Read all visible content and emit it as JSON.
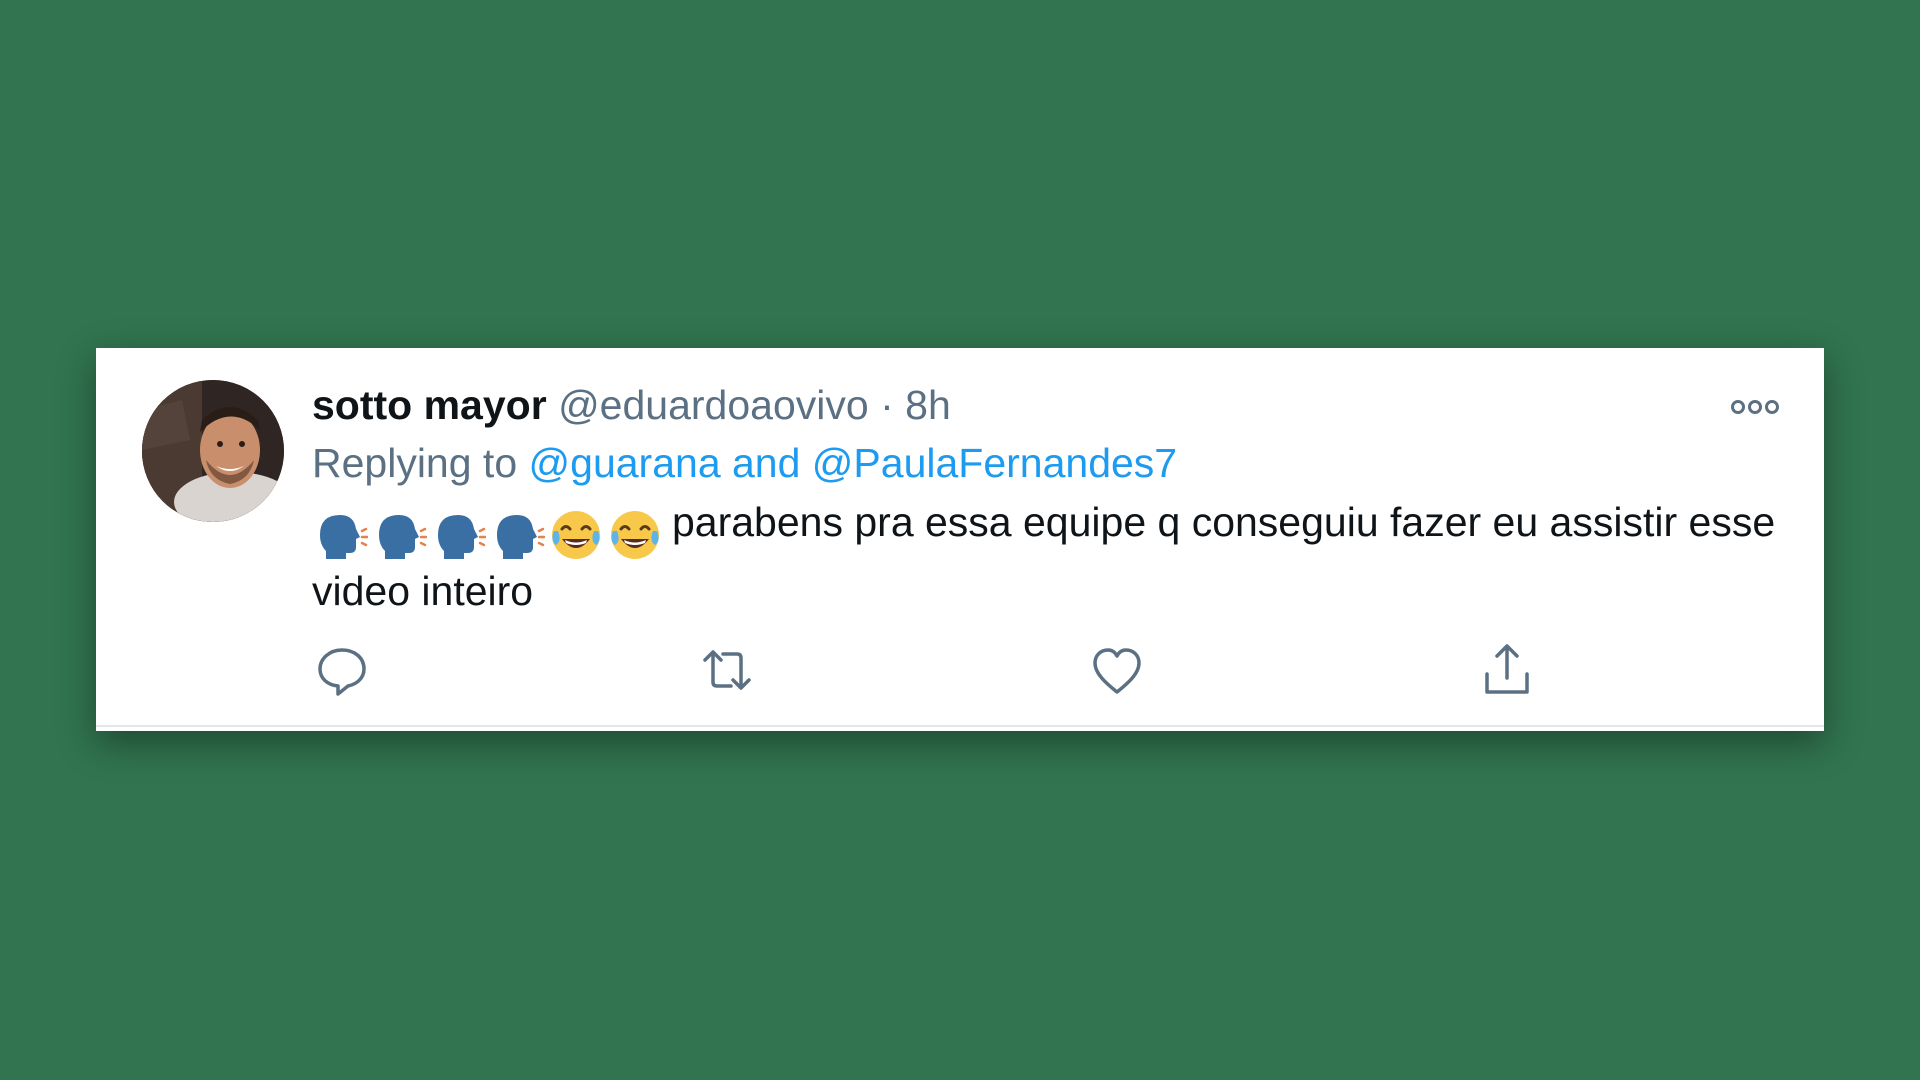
{
  "tweet": {
    "display_name": "sotto mayor",
    "handle": "@eduardoaovivo",
    "separator": "·",
    "time": "8h",
    "reply_prefix": "Replying to",
    "reply_targets": "@guarana and @PaulaFernandes7",
    "emojis": [
      "speaking-head-icon",
      "speaking-head-icon",
      "speaking-head-icon",
      "speaking-head-icon",
      "tears-of-joy-icon",
      "tears-of-joy-icon"
    ],
    "text": "parabens pra essa equipe q conseguiu fazer eu assistir esse video inteiro"
  },
  "actions": [
    "reply-icon",
    "retweet-icon",
    "like-icon",
    "share-icon"
  ],
  "colors": {
    "background": "#31744f",
    "card": "#ffffff",
    "link": "#1d9bf0",
    "secondary_text": "#5b7083",
    "primary_text": "#0f1419"
  }
}
